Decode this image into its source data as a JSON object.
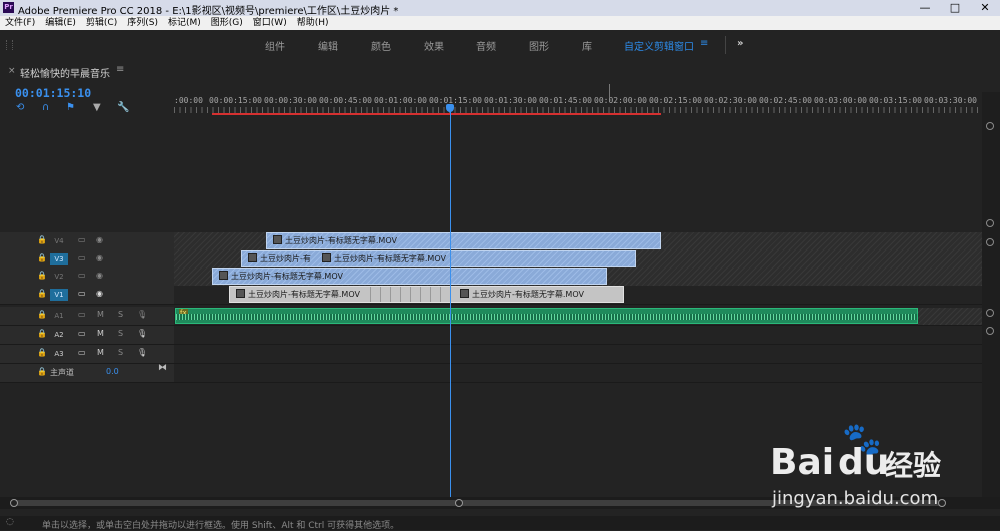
{
  "window": {
    "app_icon": "Pr",
    "title": "Adobe Premiere Pro CC 2018 - E:\\1影视区\\视频号\\premiere\\工作区\\土豆炒肉片 *",
    "buttons": [
      "—",
      "□",
      "✕"
    ]
  },
  "menu": [
    "文件(F)",
    "编辑(E)",
    "剪辑(C)",
    "序列(S)",
    "标记(M)",
    "图形(G)",
    "窗口(W)",
    "帮助(H)"
  ],
  "workspaces": {
    "items": [
      "组件",
      "编辑",
      "颜色",
      "效果",
      "音频",
      "图形",
      "库",
      "自定义剪辑窗口"
    ],
    "active": "自定义剪辑窗口",
    "menu_icon": "≡",
    "more_icon": "»"
  },
  "sequence": {
    "close": "×",
    "name": "轻松愉快的早晨音乐",
    "menu_icon": "≡",
    "timecode": "00:01:15:10"
  },
  "tools": [
    "snap-icon",
    "linked-selection-icon",
    "add-marker-icon",
    "marker-icon",
    "wrench-icon"
  ],
  "ruler": {
    "labels": [
      ":00:00",
      "00:00:15:00",
      "00:00:30:00",
      "00:00:45:00",
      "00:01:00:00",
      "00:01:15:00",
      "00:01:30:00",
      "00:01:45:00",
      "00:02:00:00",
      "00:02:15:00",
      "00:02:30:00",
      "00:02:45:00",
      "00:03:00:00",
      "00:03:15:00",
      "00:03:30:00"
    ]
  },
  "video_tracks": [
    {
      "label": "V4",
      "active": false
    },
    {
      "label": "V3",
      "active": true
    },
    {
      "label": "V2",
      "active": false
    },
    {
      "label": "V1",
      "active": true
    }
  ],
  "audio_tracks": [
    {
      "label": "A1",
      "m": "M",
      "s": "S"
    },
    {
      "label": "A2",
      "m": "M",
      "s": "S"
    },
    {
      "label": "A3",
      "m": "M",
      "s": "S"
    }
  ],
  "master": {
    "label": "主声道",
    "value": "0.0"
  },
  "clips": {
    "v4": "土豆炒肉片-有标题无字幕.MOV",
    "v3a": "土豆炒肉片-有",
    "v3b": "土豆炒肉片-有标题无字幕.MOV",
    "v2": "土豆炒肉片-有标题无字幕.MOV",
    "v1a": "土豆炒肉片-有标题无字幕.MOV",
    "v1b": "土豆炒肉片-有标题无字幕.MOV",
    "a1": "fx"
  },
  "status": "单击以选择，或单击空白处并拖动以进行框选。使用 Shift、Alt 和 Ctrl 可获得其他选项。",
  "watermark": {
    "brand": "Bai",
    "brand2": "du",
    "cn": "经验",
    "url": "jingyan.baidu.com"
  },
  "colors": {
    "accent": "#3a90ee",
    "video_clip": "#8fb1de",
    "audio_clip": "#1f8a5c",
    "work_area": "#d63030"
  }
}
